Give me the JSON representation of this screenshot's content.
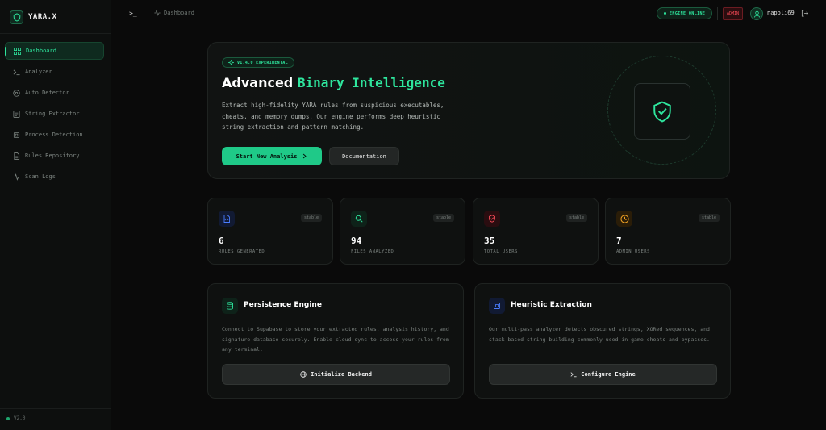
{
  "app": {
    "brand": "YARA.X",
    "version": "V2.0"
  },
  "sidebar": {
    "items": [
      {
        "label": "Dashboard",
        "icon": "grid-icon",
        "active": true
      },
      {
        "label": "Analyzer",
        "icon": "terminal-icon"
      },
      {
        "label": "Auto Detector",
        "icon": "target-icon"
      },
      {
        "label": "String Extractor",
        "icon": "document-icon"
      },
      {
        "label": "Process Detection",
        "icon": "cpu-icon"
      },
      {
        "label": "Rules Repository",
        "icon": "file-icon"
      },
      {
        "label": "Scan Logs",
        "icon": "activity-icon"
      }
    ]
  },
  "topbar": {
    "prompt": ">_",
    "breadcrumb": "Dashboard",
    "engine_status": "ENGINE ONLINE",
    "role_badge": "ADMIN",
    "username": "napoli69"
  },
  "hero": {
    "version_pill": "V1.4.0 EXPERIMENTAL",
    "title_plain": "Advanced ",
    "title_accent": "Binary Intelligence",
    "description": "Extract high-fidelity YARA rules from suspicious executables, cheats, and memory dumps. Our engine performs deep heuristic string extraction and pattern matching.",
    "primary_button": "Start New Analysis",
    "secondary_button": "Documentation"
  },
  "stats": [
    {
      "value": "6",
      "label": "RULES GENERATED",
      "badge": "stable",
      "icon": "file-code-icon",
      "color": "#4a7dff"
    },
    {
      "value": "94",
      "label": "FILES ANALYZED",
      "badge": "stable",
      "icon": "search-icon",
      "color": "#2ee59d"
    },
    {
      "value": "35",
      "label": "TOTAL USERS",
      "badge": "stable",
      "icon": "shield-icon",
      "color": "#ff4d5a"
    },
    {
      "value": "7",
      "label": "ADMIN USERS",
      "badge": "stable",
      "icon": "clock-icon",
      "color": "#f5a524"
    }
  ],
  "features": [
    {
      "title": "Persistence Engine",
      "icon": "database-icon",
      "description": "Connect to Supabase to store your extracted rules, analysis history, and signature database securely. Enable cloud sync to access your rules from any terminal.",
      "button": "Initialize Backend",
      "button_icon": "globe-icon"
    },
    {
      "title": "Heuristic Extraction",
      "icon": "chip-icon",
      "description": "Our multi-pass analyzer detects obscured strings, XORed sequences, and stack-based string building commonly used in game cheats and bypasses.",
      "button": "Configure Engine",
      "button_icon": "terminal-icon"
    }
  ],
  "colors": {
    "accent": "#2ee59d",
    "danger": "#ff4d5a",
    "background": "#0a0a0a"
  }
}
